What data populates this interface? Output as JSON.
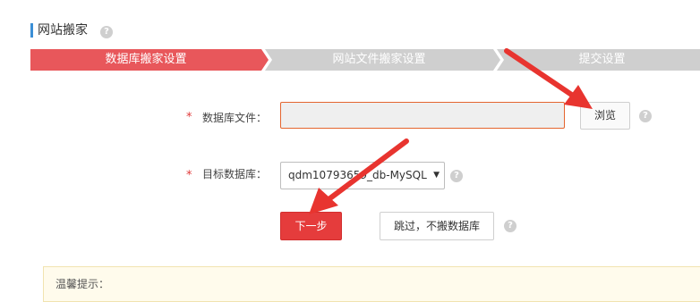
{
  "page": {
    "title": "网站搬家",
    "help_glyph": "?"
  },
  "steps": [
    {
      "label": "数据库搬家设置",
      "active": true
    },
    {
      "label": "网站文件搬家设置",
      "active": false
    },
    {
      "label": "提交设置",
      "active": false
    }
  ],
  "form": {
    "required_mark": "*",
    "db_file": {
      "label": "数据库文件：",
      "value": "",
      "browse_label": "浏览"
    },
    "target_db": {
      "label": "目标数据库：",
      "selected": "qdm10793659_db-MySQL",
      "caret": "▼"
    },
    "next_label": "下一步",
    "skip_label": "跳过，不搬数据库"
  },
  "tip": {
    "title": "温馨提示："
  },
  "colors": {
    "accent": "#e53c3c",
    "step_active": "#e8575b",
    "step_inactive": "#cfcfcf",
    "annotation": "#e8342f"
  }
}
